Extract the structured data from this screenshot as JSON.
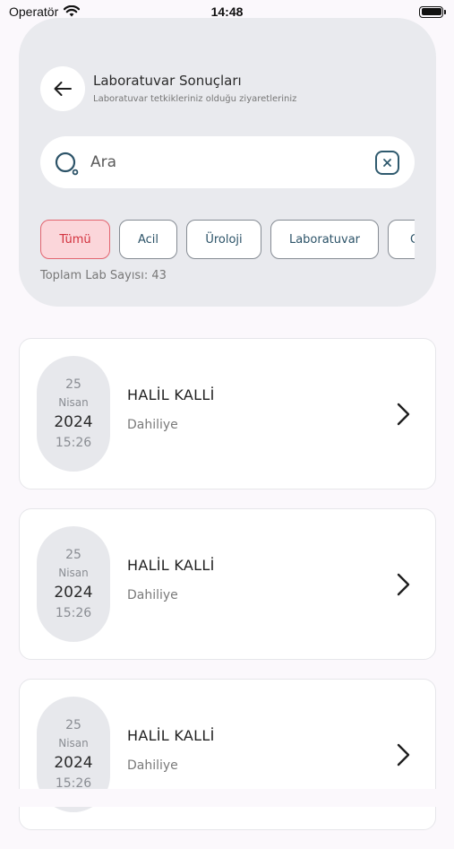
{
  "status_bar": {
    "carrier": "Operatör",
    "time": "14:48"
  },
  "header": {
    "title": "Laboratuvar Sonuçları",
    "subtitle": "Laboratuvar tetkikleriniz olduğu ziyaretleriniz"
  },
  "search": {
    "placeholder": "Ara",
    "value": ""
  },
  "filters": [
    {
      "label": "Tümü",
      "active": true
    },
    {
      "label": "Acil",
      "active": false
    },
    {
      "label": "Üroloji",
      "active": false
    },
    {
      "label": "Laboratuvar",
      "active": false
    },
    {
      "label": "G",
      "active": false
    }
  ],
  "total_count_text": "Toplam Lab Sayısı: 43",
  "visits": [
    {
      "day": "25",
      "month": "Nisan",
      "year": "2024",
      "time": "15:26",
      "patient": "HALİL KALLİ",
      "department": "Dahiliye"
    },
    {
      "day": "25",
      "month": "Nisan",
      "year": "2024",
      "time": "15:26",
      "patient": "HALİL KALLİ",
      "department": "Dahiliye"
    },
    {
      "day": "25",
      "month": "Nisan",
      "year": "2024",
      "time": "15:26",
      "patient": "HALİL KALLİ",
      "department": "Dahiliye"
    }
  ],
  "colors": {
    "accent": "#2c5368",
    "active_chip_bg": "#fbd6da",
    "active_chip_text": "#d2313d",
    "header_bg": "#e9eaee"
  },
  "icons": {
    "back": "arrow-left-icon",
    "search": "search-icon",
    "clear": "clear-icon",
    "chevron": "chevron-right-icon"
  }
}
